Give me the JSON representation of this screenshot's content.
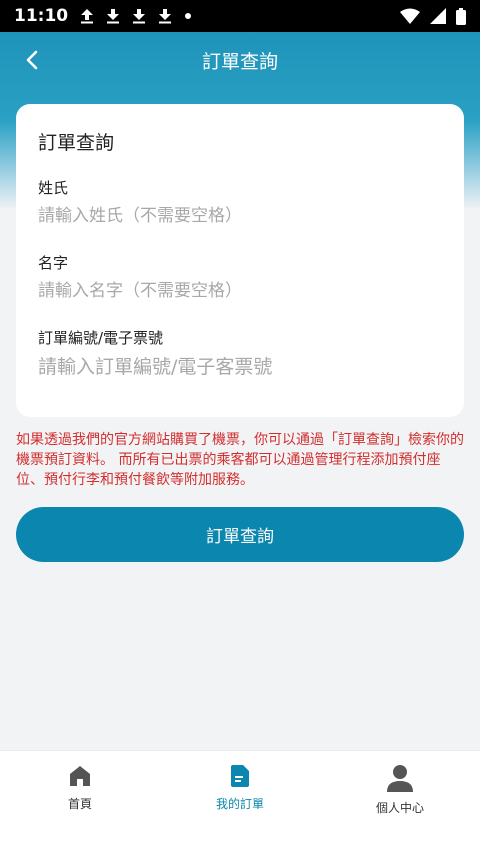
{
  "status_bar": {
    "time": "11:10",
    "icons": [
      "upload-icon",
      "download-icon",
      "download-icon",
      "download-icon",
      "dot-icon",
      "wifi-icon",
      "signal-icon",
      "battery-icon"
    ]
  },
  "header": {
    "title": "訂單查詢"
  },
  "card": {
    "title": "訂單查詢",
    "fields": [
      {
        "label": "姓氏",
        "value": "",
        "placeholder": "請輸入姓氏（不需要空格）"
      },
      {
        "label": "名字",
        "value": "",
        "placeholder": "請輸入名字（不需要空格）"
      },
      {
        "label": "訂單編號/電子票號",
        "value": "",
        "placeholder": "請輸入訂單編號/電子客票號"
      }
    ]
  },
  "notice": "如果透過我們的官方網站購買了機票，你可以通過「訂單查詢」檢索你的機票預訂資料。 而所有已出票的乘客都可以通過管理行程添加預付座位、預付行李和預付餐飲等附加服務。",
  "submit_label": "訂單查詢",
  "tabs": [
    {
      "label": "首頁",
      "icon": "home-icon",
      "active": false
    },
    {
      "label": "我的訂單",
      "icon": "document-icon",
      "active": true
    },
    {
      "label": "個人中心",
      "icon": "person-icon",
      "active": false
    }
  ],
  "colors": {
    "primary": "#0b86ae",
    "header": "#1b8fb6",
    "notice": "#d32f2f",
    "tab_inactive": "#555555"
  }
}
